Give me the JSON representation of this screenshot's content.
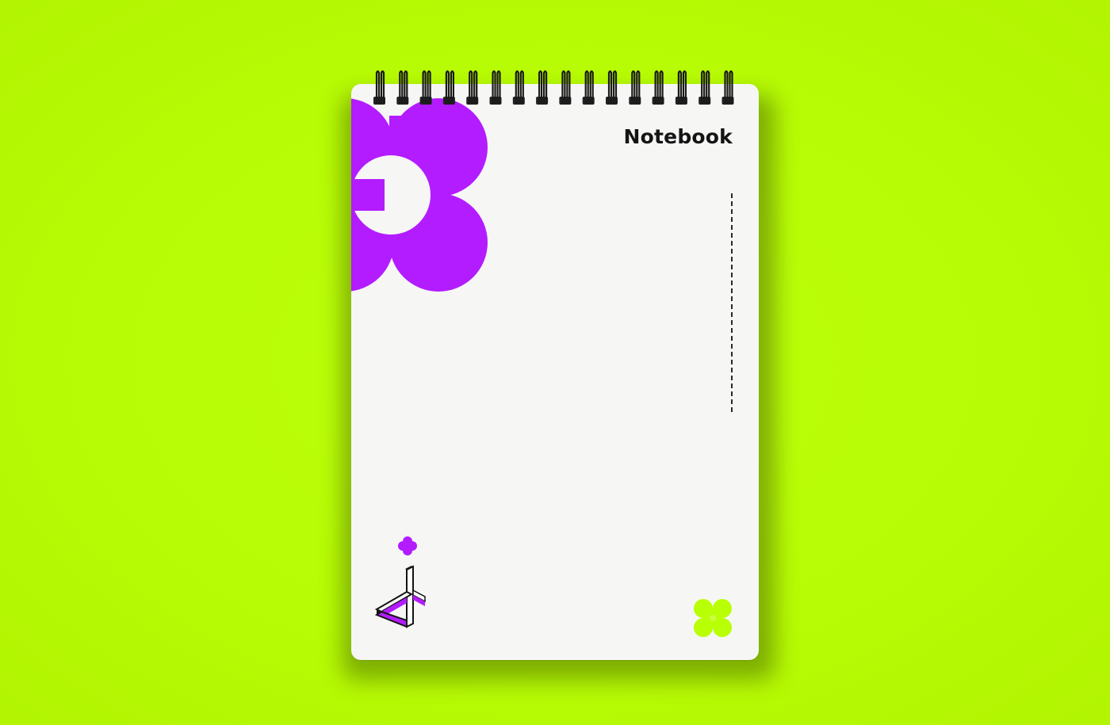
{
  "notebook": {
    "title": "Notebook"
  },
  "colors": {
    "background": "#b9ff05",
    "paper": "#f6f6f5",
    "accent_purple": "#b31cff",
    "accent_green": "#b9ff05",
    "ink": "#141414"
  },
  "icons": {
    "top_left": "purple-flower-shape",
    "bottom_left": "isometric-logo-mark",
    "bottom_right": "green-clover-icon",
    "binding": "spiral-binding"
  }
}
